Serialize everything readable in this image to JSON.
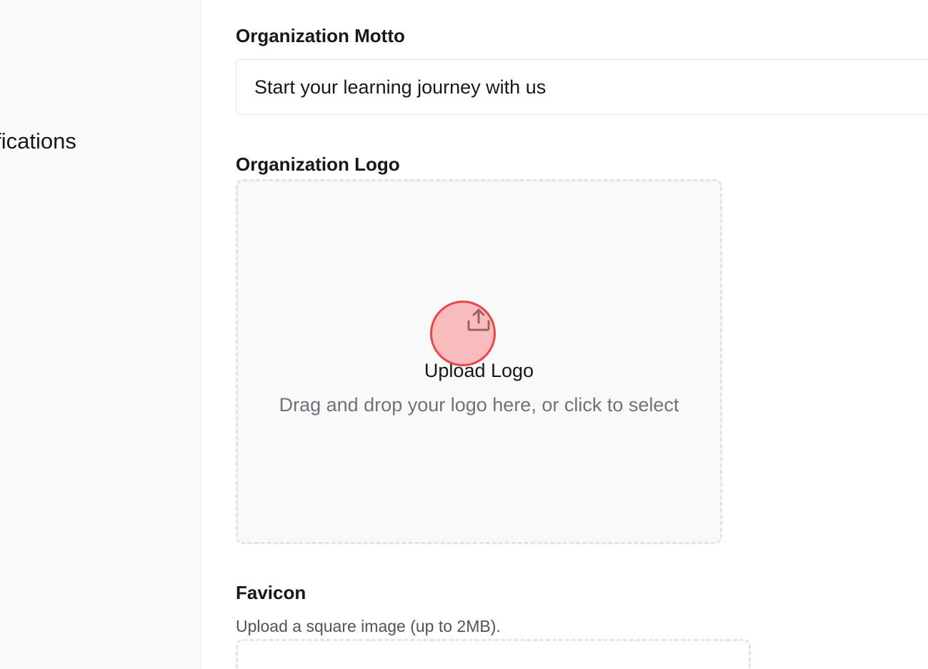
{
  "sidebar": {
    "items": [
      {
        "label": "Notifications"
      }
    ]
  },
  "form": {
    "motto": {
      "label": "Organization Motto",
      "value": "Start your learning journey with us"
    },
    "logo": {
      "label": "Organization Logo",
      "dropzone_title": "Upload Logo",
      "dropzone_hint": "Drag and drop your logo here, or click to select",
      "icon": "upload-icon"
    },
    "favicon": {
      "label": "Favicon",
      "description": "Upload a square image (up to 2MB)."
    }
  },
  "colors": {
    "click_marker": "#ef4444",
    "dropzone_background": "#f9f9f9",
    "border": "#e4e4e7",
    "muted_text": "#71717a"
  }
}
